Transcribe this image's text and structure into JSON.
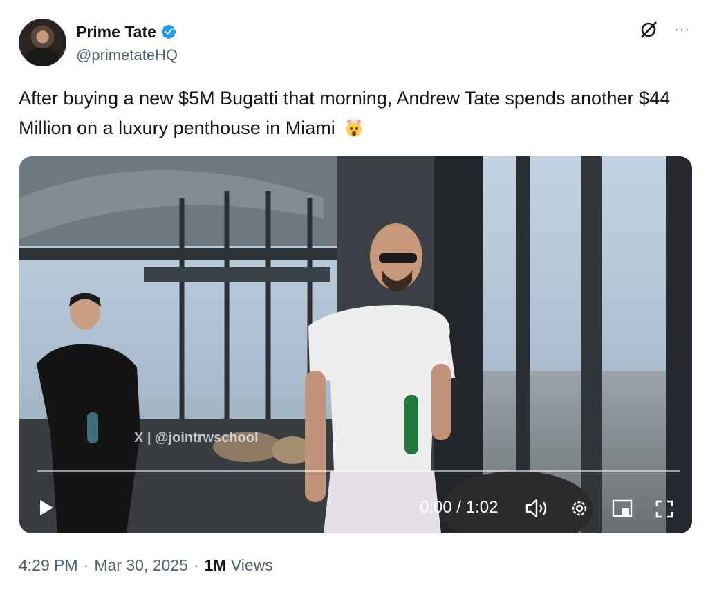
{
  "author": {
    "name": "Prime Tate",
    "handle": "@primetateHQ",
    "verified": true,
    "avatar": "profile-photo"
  },
  "header_actions": {
    "grok_icon": "grok-icon",
    "more_icon": "more-icon",
    "more_label": "···"
  },
  "tweet": {
    "text": "After buying a new $5M Bugatti that morning, Andrew Tate spends another $44 Million on a luxury penthouse in Miami",
    "emoji": "exploding-head-emoji"
  },
  "video": {
    "watermark": "X | @jointrwschool",
    "time": "0:00 / 1:02",
    "progress": 0,
    "controls": [
      "play-icon",
      "volume-icon",
      "settings-icon",
      "pip-icon",
      "fullscreen-icon"
    ]
  },
  "meta": {
    "time": "4:29 PM",
    "sep1": "·",
    "date": "Mar 30, 2025",
    "sep2": "·",
    "views_count": "1M",
    "views_label": "Views"
  },
  "colors": {
    "text": "#0f1419",
    "secondary": "#536471",
    "verified": "#1d9bf0"
  }
}
